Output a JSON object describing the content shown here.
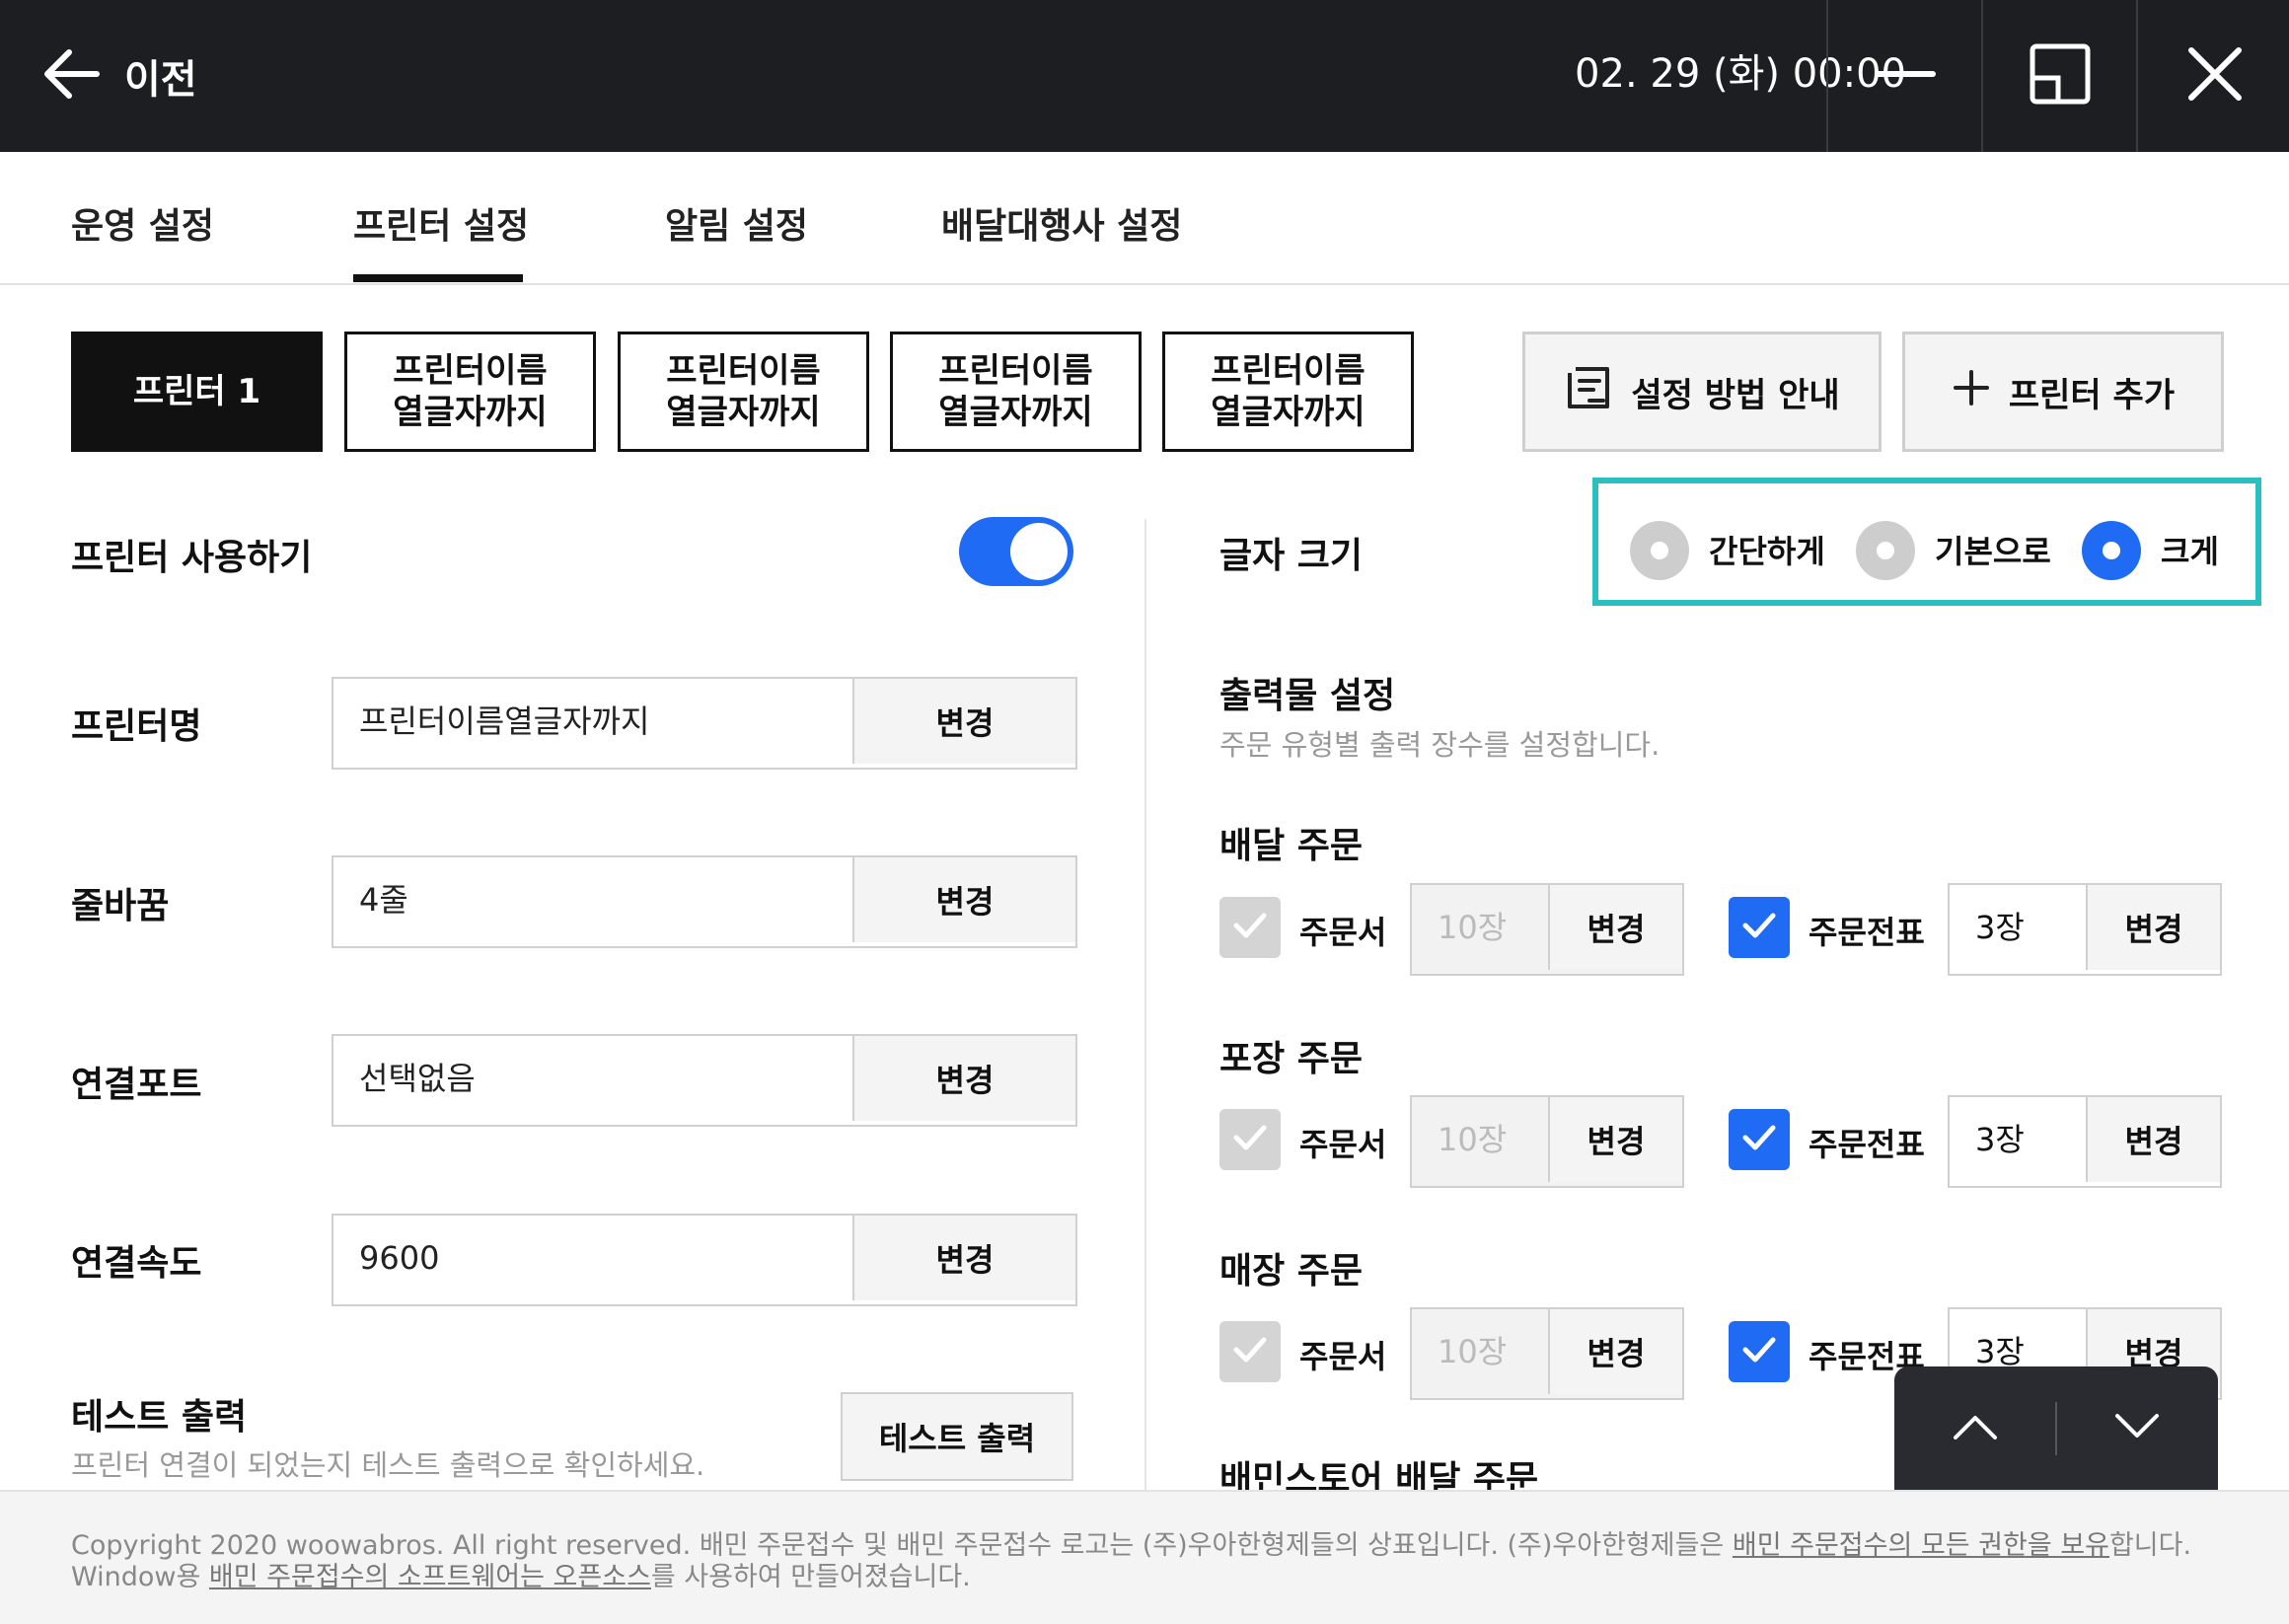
{
  "titlebar": {
    "back_label": "이전",
    "datetime": "02. 29 (화) 00:00"
  },
  "tabs": [
    {
      "label": "운영 설정",
      "active": false
    },
    {
      "label": "프린터 설정",
      "active": true
    },
    {
      "label": "알림 설정",
      "active": false
    },
    {
      "label": "배달대행사 설정",
      "active": false
    }
  ],
  "printers": [
    {
      "label": "프린터 1",
      "active": true
    },
    {
      "label": "프린터이름\n열글자까지",
      "active": false
    },
    {
      "label": "프린터이름\n열글자까지",
      "active": false
    },
    {
      "label": "프린터이름\n열글자까지",
      "active": false
    },
    {
      "label": "프린터이름\n열글자까지",
      "active": false
    }
  ],
  "actions": {
    "guide_label": "설정 방법 안내",
    "add_label": "프린터 추가"
  },
  "left": {
    "use_printer_label": "프린터 사용하기",
    "use_printer_on": true,
    "fields": [
      {
        "label": "프린터명",
        "value": "프린터이름열글자까지",
        "button": "변경"
      },
      {
        "label": "줄바꿈",
        "value": "4줄",
        "button": "변경"
      },
      {
        "label": "연결포트",
        "value": "선택없음",
        "button": "변경"
      },
      {
        "label": "연결속도",
        "value": "9600",
        "button": "변경"
      }
    ],
    "test": {
      "label": "테스트 출력",
      "description": "프린터 연결이 되었는지 테스트 출력으로 확인하세요.",
      "button": "테스트 출력"
    }
  },
  "right": {
    "font_size_label": "글자 크기",
    "font_size_options": [
      {
        "label": "간단하게",
        "selected": false
      },
      {
        "label": "기본으로",
        "selected": false
      },
      {
        "label": "크게",
        "selected": true
      }
    ],
    "highlight_color": "#2bbfbf",
    "output_title": "출력물 설정",
    "output_description": "주문 유형별 출력 장수를 설정합니다.",
    "order_types": [
      {
        "title": "배달 주문",
        "receipt": {
          "label": "주문서",
          "checked": false,
          "qty": "10장",
          "button": "변경"
        },
        "slip": {
          "label": "주문전표",
          "checked": true,
          "qty": "3장",
          "button": "변경"
        }
      },
      {
        "title": "포장 주문",
        "receipt": {
          "label": "주문서",
          "checked": false,
          "qty": "10장",
          "button": "변경"
        },
        "slip": {
          "label": "주문전표",
          "checked": true,
          "qty": "3장",
          "button": "변경"
        }
      },
      {
        "title": "매장 주문",
        "receipt": {
          "label": "주문서",
          "checked": false,
          "qty": "10장",
          "button": "변경"
        },
        "slip": {
          "label": "주문전표",
          "checked": true,
          "qty": "3장",
          "button": "변경"
        }
      }
    ],
    "next_section_title": "배민스토어 배달 주문"
  },
  "footer": {
    "line1_a": "Copyright 2020 woowabros. All right reserved. 배민 주문접수 및 배민 주문접수 로고는 (주)우아한형제들의 상표입니다. (주)우아한형제들은 ",
    "line1_link": "배민 주문접수의 모든 권한을 보유",
    "line1_b": "합니다.",
    "line2_a": "Window용 ",
    "line2_link": "배민 주문접수의 소프트웨어는 오픈소스",
    "line2_b": "를 사용하여 만들어졌습니다."
  },
  "colors": {
    "topbar": "#1d1e22",
    "accent_blue": "#1f6bf3",
    "active_chip": "#111111"
  }
}
